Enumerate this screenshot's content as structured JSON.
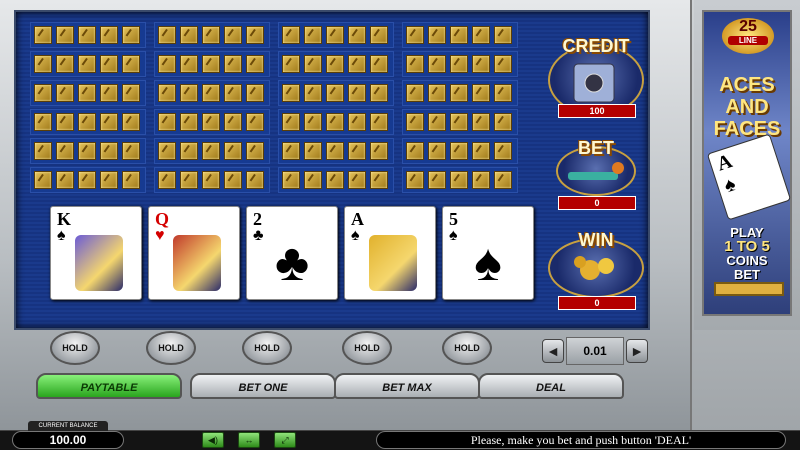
{
  "cards": [
    {
      "rank": "K",
      "suit": "♠",
      "color": "black",
      "face": true,
      "face_color": "#6b5bd6"
    },
    {
      "rank": "Q",
      "suit": "♥",
      "color": "red",
      "face": true,
      "face_color": "#c0392b"
    },
    {
      "rank": "2",
      "suit": "♣",
      "color": "black",
      "face": false
    },
    {
      "rank": "A",
      "suit": "♠",
      "color": "black",
      "face": true,
      "face_color": "#e1b12c"
    },
    {
      "rank": "5",
      "suit": "♠",
      "color": "black",
      "face": false
    }
  ],
  "hold_label": "HOLD",
  "credit": {
    "title": "CREDIT",
    "value": "100"
  },
  "bet": {
    "title": "BET",
    "value": "0"
  },
  "win": {
    "title": "WIN",
    "value": "0"
  },
  "promo": {
    "lines": "25",
    "line_label": "LINE",
    "title": "ACES AND FACES",
    "play1": "PLAY",
    "play2": "1 TO 5",
    "play3": "COINS",
    "play4": "BET"
  },
  "coin": {
    "value": "0.01",
    "minus": "◄",
    "plus": "►"
  },
  "buttons": {
    "paytable": "PAYTABLE",
    "bet_one": "BET ONE",
    "bet_max": "BET MAX",
    "deal": "DEAL"
  },
  "status": {
    "balance_label": "CURRENT BALANCE",
    "balance": "100.00",
    "message": "Please, make you bet and push button  'DEAL'"
  },
  "icons": [
    "sound-icon",
    "arrows-icon",
    "fullscreen-icon"
  ],
  "colors": {
    "screen": "#1a3a8c",
    "value_box": "#b40000",
    "paytable": "#2aa51e"
  }
}
